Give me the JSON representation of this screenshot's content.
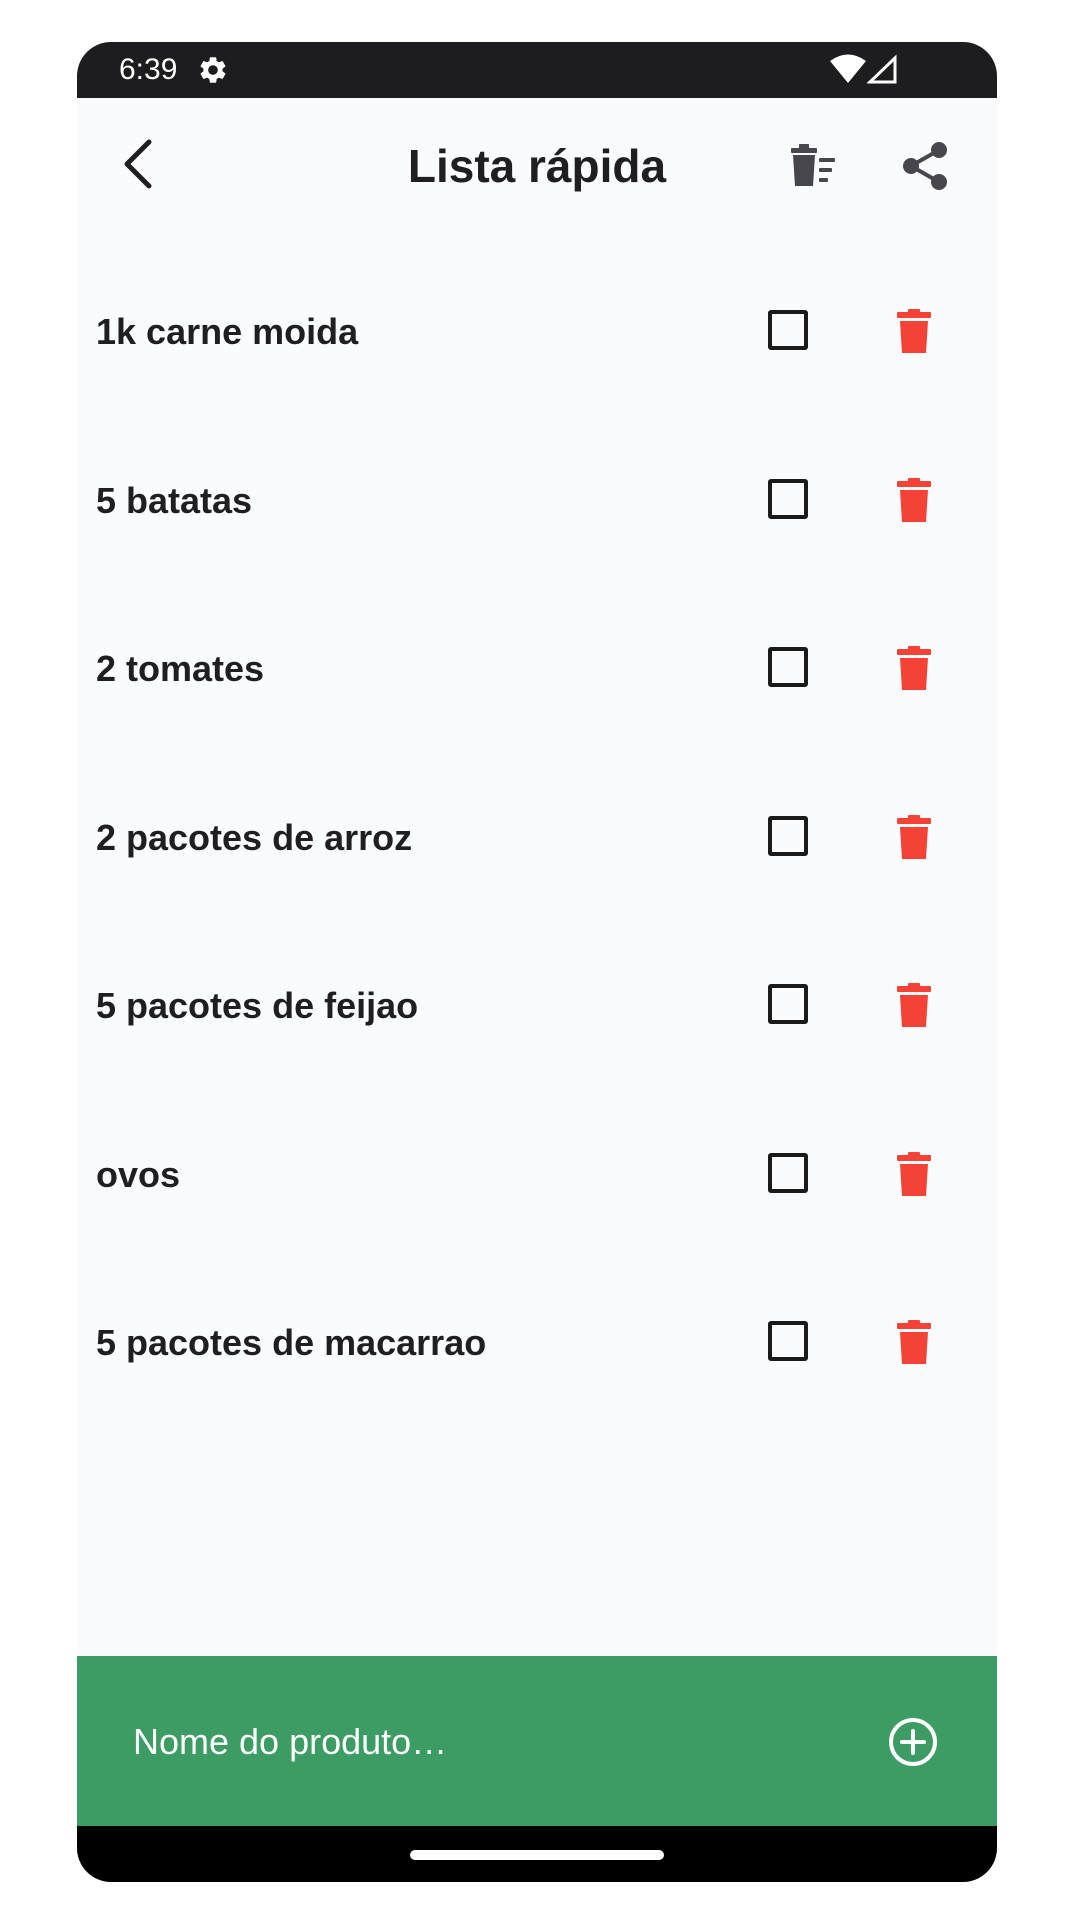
{
  "status_bar": {
    "time": "6:39",
    "icons": [
      "gear-icon",
      "wifi-icon",
      "signal-icon"
    ]
  },
  "app_bar": {
    "title": "Lista rápida",
    "back_icon": "chevron-left-icon",
    "clear_list_icon": "delete-sweep-icon",
    "share_icon": "share-icon"
  },
  "items": [
    {
      "label": "1k carne moida",
      "checked": false
    },
    {
      "label": "5 batatas",
      "checked": false
    },
    {
      "label": "2 tomates",
      "checked": false
    },
    {
      "label": "2 pacotes de arroz",
      "checked": false
    },
    {
      "label": "5 pacotes de feijao",
      "checked": false
    },
    {
      "label": "ovos",
      "checked": false
    },
    {
      "label": "5 pacotes de macarrao",
      "checked": false
    }
  ],
  "input": {
    "placeholder": "Nome do produto…",
    "value": "",
    "add_icon": "add-circle-icon"
  },
  "colors": {
    "accent_green": "#3c9c63",
    "delete_red": "#f44336",
    "text_dark": "#1f1f23",
    "background": "#f9fbfd"
  }
}
